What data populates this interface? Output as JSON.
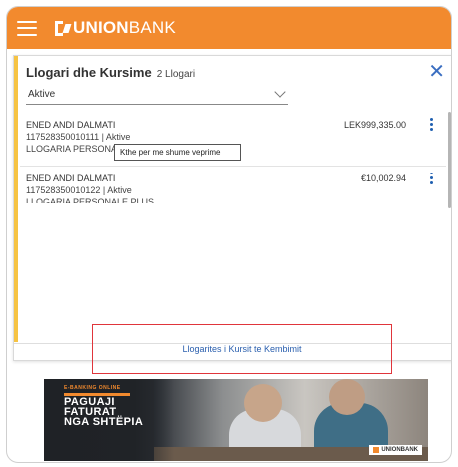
{
  "brand": {
    "logo_bold": "UNION",
    "logo_regular": "BANK",
    "accent": "#f28a2e",
    "highlight": "#f6c343",
    "link_color": "#2a5fae"
  },
  "panel": {
    "title": "Llogari dhe Kursime",
    "count": "2 Llogari",
    "filter_value": "Aktive",
    "close_icon": "close-icon"
  },
  "accounts": [
    {
      "name": "ENED ANDI DALMATI",
      "number": "117528350010111 | Aktive",
      "type": "LLOGARIA PERSONALE",
      "amount": "LEK999,335.00"
    },
    {
      "name": "ENED ANDI DALMATI",
      "number": "117528350010122 | Aktive",
      "type": "LLOGARIA PERSONALE PLUS",
      "amount": "€10,002.94"
    }
  ],
  "tooltip": "Kthe per me shume veprime",
  "exchange_link": "Llogarites i Kursit te Kembimit",
  "banner": {
    "tag": "E-BANKING ONLINE",
    "line1": "PAGUAJI",
    "line2": "FATURAT",
    "line3": "NGA SHTËPIA",
    "brand": "UNIONBANK"
  }
}
